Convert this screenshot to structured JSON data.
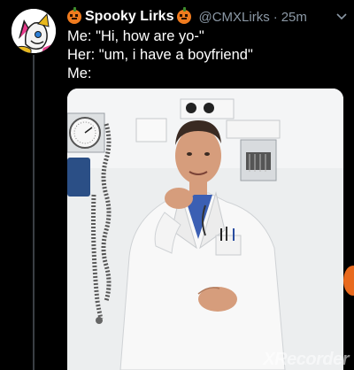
{
  "tweet": {
    "display_name": "Spooky Lirks",
    "handle": "@CMXLirks",
    "separator": "·",
    "timestamp": "25m",
    "more_icon": "chevron-down-icon",
    "lines": [
      "Me: \"Hi, how are yo-\"",
      "Her: \"um, i have a boyfriend\"",
      "Me:"
    ]
  },
  "watermark": "XRecorder",
  "colors": {
    "background": "#000000",
    "secondary_text": "#8b98a5",
    "pumpkin": "#f07b1e",
    "thread_line": "#3a3f44"
  }
}
